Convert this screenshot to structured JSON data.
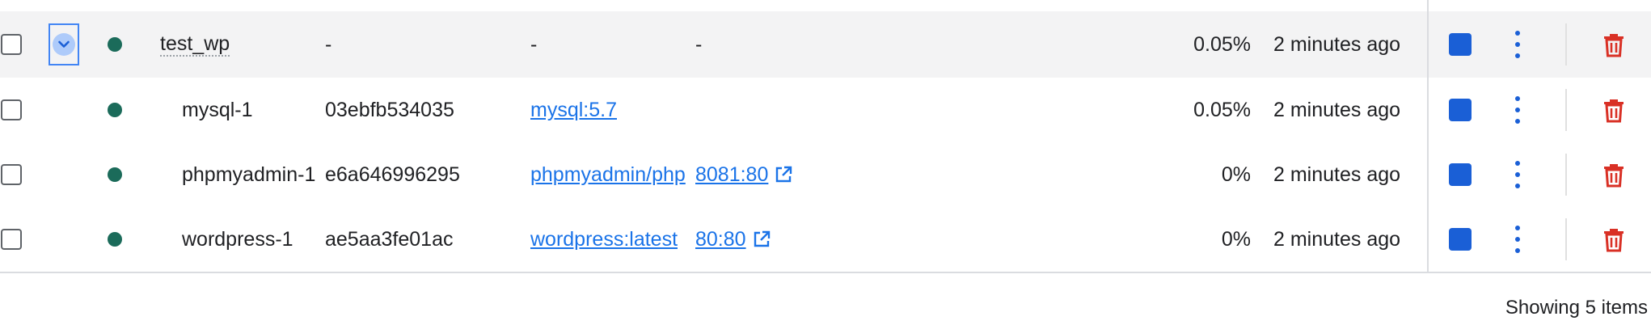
{
  "colors": {
    "status_running": "#1b6b5a",
    "link": "#1a73e8",
    "stop_button": "#1a5fd6",
    "delete_icon": "#d93025",
    "group_row_bg": "#f3f3f4"
  },
  "icons": {
    "expand": "chevron-down-icon",
    "port_link": "external-link-icon",
    "stop": "stop-icon",
    "more": "more-vert-icon",
    "delete": "trash-icon"
  },
  "group": {
    "name": "test_wp",
    "container_id": "-",
    "image": "-",
    "port": "-",
    "cpu": "0.05%",
    "last_started": "2 minutes ago"
  },
  "containers": [
    {
      "name": "mysql-1",
      "container_id": "03ebfb534035",
      "image": "mysql:5.7",
      "port": "",
      "cpu": "0.05%",
      "last_started": "2 minutes ago"
    },
    {
      "name": "phpmyadmin-1",
      "container_id": "e6a646996295",
      "image": "phpmyadmin/php",
      "port": "8081:80",
      "cpu": "0%",
      "last_started": "2 minutes ago"
    },
    {
      "name": "wordpress-1",
      "container_id": "ae5aa3fe01ac",
      "image": "wordpress:latest",
      "port": "80:80",
      "cpu": "0%",
      "last_started": "2 minutes ago"
    }
  ],
  "footer": {
    "summary": "Showing 5 items"
  }
}
